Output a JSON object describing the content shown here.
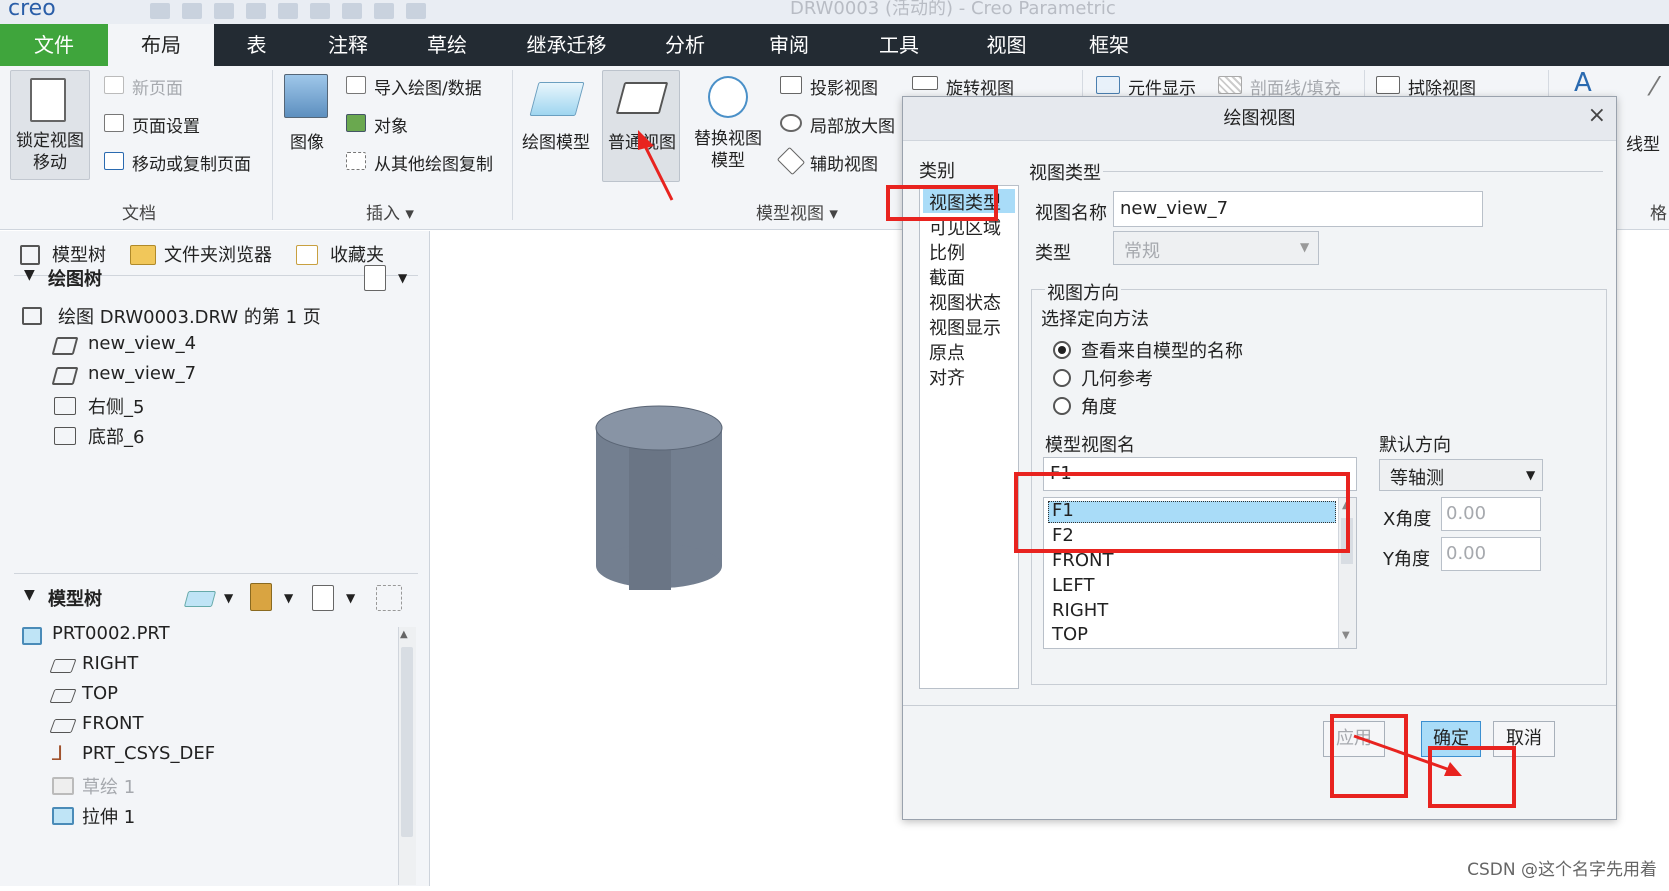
{
  "titlebar": {
    "app_logo": "creo",
    "window_title": "DRW0003 (活动的) - Creo Parametric"
  },
  "tabs": [
    "文件",
    "布局",
    "表",
    "注释",
    "草绘",
    "继承迁移",
    "分析",
    "审阅",
    "工具",
    "视图",
    "框架"
  ],
  "ribbon": {
    "lock_view": "锁定视图\n移动",
    "new_page": "新页面",
    "page_setup": "页面设置",
    "move_copy_page": "移动或复制页面",
    "doc_group": "文档",
    "image": "图像",
    "import_drawing": "导入绘图/数据",
    "object": "对象",
    "copy_from_drawing": "从其他绘图复制",
    "insert_group": "插入",
    "drawing_model": "绘图模型",
    "general_view": "普通视图",
    "replace_view": "替换视图\n模型",
    "projection_view": "投影视图",
    "detail_view": "局部放大图",
    "aux_view": "辅助视图",
    "rotate_view": "旋转视图",
    "model_views_group": "模型视图",
    "element_display": "元件显示",
    "section_line": "剖面线/填充",
    "erase_view": "拭除视图",
    "line_label": "线型",
    "format_label": "格"
  },
  "left_panel": {
    "tabs": [
      "模型树",
      "文件夹浏览器",
      "收藏夹"
    ],
    "drawing_tree_title": "绘图树",
    "drawing_tree": [
      "绘图 DRW0003.DRW 的第 1 页",
      "new_view_4",
      "new_view_7",
      "右侧_5",
      "底部_6"
    ],
    "model_tree_title": "模型树",
    "model_tree": [
      "PRT0002.PRT",
      "RIGHT",
      "TOP",
      "FRONT",
      "PRT_CSYS_DEF",
      "草绘 1",
      "拉伸 1"
    ]
  },
  "dialog": {
    "title": "绘图视图",
    "close": "×",
    "category_label": "类别",
    "categories": [
      "视图类型",
      "可见区域",
      "比例",
      "截面",
      "视图状态",
      "视图显示",
      "原点",
      "对齐"
    ],
    "section_title": "视图类型",
    "view_name_label": "视图名称",
    "view_name_value": "new_view_7",
    "type_label": "类型",
    "type_value": "常规",
    "orientation_title": "视图方向",
    "orientation_method": "选择定向方法",
    "radios": [
      "查看来自模型的名称",
      "几何参考",
      "角度"
    ],
    "model_view_name_label": "模型视图名",
    "model_view_name_value": "F1",
    "model_views": [
      "F1",
      "F2",
      "FRONT",
      "LEFT",
      "RIGHT",
      "TOP"
    ],
    "default_orientation_label": "默认方向",
    "default_orientation_value": "等轴测",
    "x_angle_label": "X角度",
    "x_angle_value": "0.00",
    "y_angle_label": "Y角度",
    "y_angle_value": "0.00",
    "apply_button": "应用",
    "ok_button": "确定",
    "cancel_button": "取消"
  },
  "watermark": "CSDN @这个名字先用着",
  "colors": {
    "accent": "#3fa53c",
    "tabbar": "#232b33",
    "highlight": "#a9dcf8",
    "annotation_red": "#e8231f"
  }
}
